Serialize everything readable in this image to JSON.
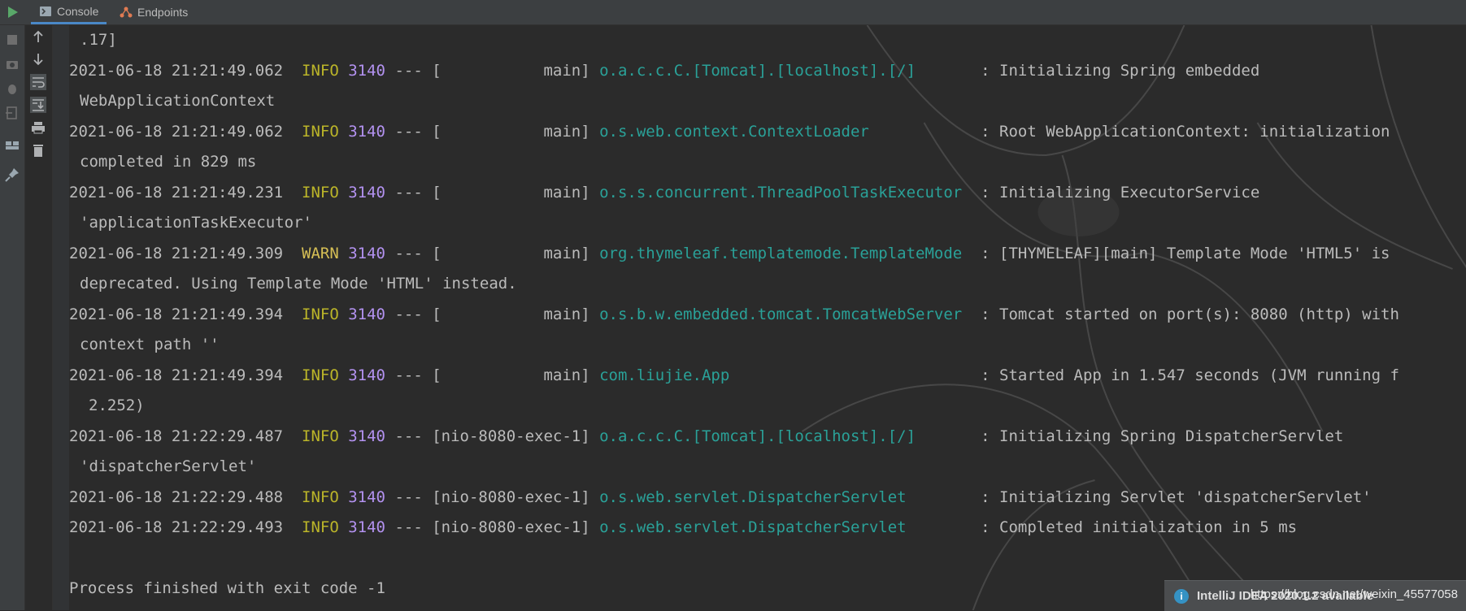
{
  "tabs": [
    {
      "label": "Console",
      "icon": "console-icon"
    },
    {
      "label": "Endpoints",
      "icon": "endpoints-icon"
    }
  ],
  "left_toolbar": [
    "run-icon",
    "stop-icon",
    "camera-icon",
    "debug-icon",
    "exit-icon",
    "layout-icon",
    "pin-icon"
  ],
  "console_toolbar": [
    "arrow-up-icon",
    "arrow-down-icon",
    "soft-wrap-icon",
    "scroll-to-end-icon",
    "print-icon",
    "trash-icon"
  ],
  "colors": {
    "info": "#bbb529",
    "warn": "#d6bf55",
    "pid": "#b392f0",
    "logger": "#2aa198",
    "text": "#bbbbbb"
  },
  "log": {
    "first_cont": ".17]",
    "entries": [
      {
        "ts": "2021-06-18 21:21:49.062",
        "level": "INFO",
        "pid": "3140",
        "thread": "--- [           main]",
        "logger": "o.a.c.c.C.[Tomcat].[localhost].[/]",
        "pad": "      ",
        "msg": ": Initializing Spring embedded",
        "cont": "WebApplicationContext"
      },
      {
        "ts": "2021-06-18 21:21:49.062",
        "level": "INFO",
        "pid": "3140",
        "thread": "--- [           main]",
        "logger": "o.s.web.context.ContextLoader",
        "pad": "           ",
        "msg": ": Root WebApplicationContext: initialization",
        "cont": "completed in 829 ms"
      },
      {
        "ts": "2021-06-18 21:21:49.231",
        "level": "INFO",
        "pid": "3140",
        "thread": "--- [           main]",
        "logger": "o.s.s.concurrent.ThreadPoolTaskExecutor",
        "pad": " ",
        "msg": ": Initializing ExecutorService",
        "cont": "'applicationTaskExecutor'"
      },
      {
        "ts": "2021-06-18 21:21:49.309",
        "level": "WARN",
        "pid": "3140",
        "thread": "--- [           main]",
        "logger": "org.thymeleaf.templatemode.TemplateMode",
        "pad": " ",
        "msg": ": [THYMELEAF][main] Template Mode 'HTML5' is",
        "cont": "deprecated. Using Template Mode 'HTML' instead."
      },
      {
        "ts": "2021-06-18 21:21:49.394",
        "level": "INFO",
        "pid": "3140",
        "thread": "--- [           main]",
        "logger": "o.s.b.w.embedded.tomcat.TomcatWebServer",
        "pad": " ",
        "msg": ": Tomcat started on port(s): 8080 (http) with",
        "cont": "context path ''"
      },
      {
        "ts": "2021-06-18 21:21:49.394",
        "level": "INFO",
        "pid": "3140",
        "thread": "--- [           main]",
        "logger": "com.liujie.App",
        "pad": "                          ",
        "msg": ": Started App in 1.547 seconds (JVM running f",
        "cont": "2.252)"
      },
      {
        "ts": "2021-06-18 21:22:29.487",
        "level": "INFO",
        "pid": "3140",
        "thread": "--- [nio-8080-exec-1]",
        "logger": "o.a.c.c.C.[Tomcat].[localhost].[/]",
        "pad": "      ",
        "msg": ": Initializing Spring DispatcherServlet",
        "cont": "'dispatcherServlet'"
      },
      {
        "ts": "2021-06-18 21:22:29.488",
        "level": "INFO",
        "pid": "3140",
        "thread": "--- [nio-8080-exec-1]",
        "logger": "o.s.web.servlet.DispatcherServlet",
        "pad": "       ",
        "msg": ": Initializing Servlet 'dispatcherServlet'",
        "cont": ""
      },
      {
        "ts": "2021-06-18 21:22:29.493",
        "level": "INFO",
        "pid": "3140",
        "thread": "--- [nio-8080-exec-1]",
        "logger": "o.s.web.servlet.DispatcherServlet",
        "pad": "       ",
        "msg": ": Completed initialization in 5 ms",
        "cont": ""
      }
    ],
    "exit_line": "Process finished with exit code -1"
  },
  "notification": {
    "title": "IntelliJ IDEA 2020.1.2 available",
    "watermark": "https://blog.csdn.net/weixin_45577058"
  }
}
